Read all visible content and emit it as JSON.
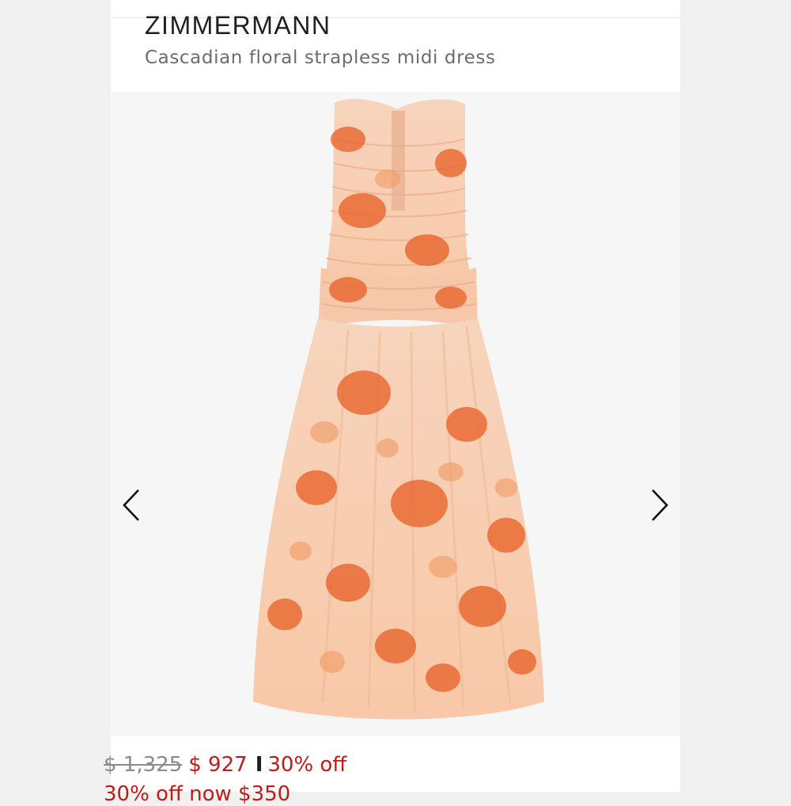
{
  "product": {
    "brand": "ZIMMERMANN",
    "name": "Cascadian floral strapless midi dress",
    "image_alt": "Cascadian floral strapless midi dress"
  },
  "pricing": {
    "original_price": "$ 1,325",
    "sale_price": "$ 927",
    "separator": "I",
    "discount": "30% off",
    "secondary_line": "30% off now $350"
  },
  "icons": {
    "prev": "chevron-left-icon",
    "next": "chevron-right-icon"
  },
  "colors": {
    "sale": "#c21b17",
    "brand_text": "#1f1f1f",
    "subtitle": "#6c6c6c",
    "dress_base": "#f8cdaf",
    "print": "#e8632a"
  }
}
